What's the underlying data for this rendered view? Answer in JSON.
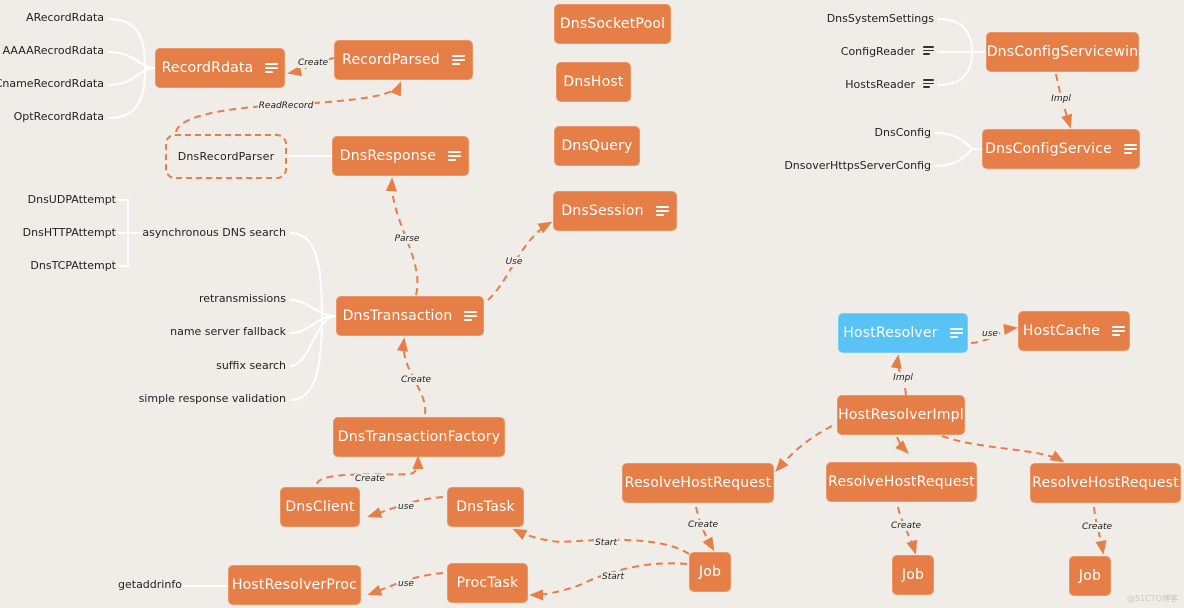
{
  "colors": {
    "node": "#e67e48",
    "highlight": "#58c3f4",
    "background": "#f0ede9",
    "edge": "#e67e48"
  },
  "nodes": {
    "record_rdata": "RecordRdata",
    "record_parsed": "RecordParsed",
    "dns_record_parser": "DnsRecordParser",
    "dns_response": "DnsResponse",
    "dns_socket_pool": "DnsSocketPool",
    "dns_host": "DnsHost",
    "dns_query": "DnsQuery",
    "dns_session": "DnsSession",
    "dns_config_service_win": "DnsConfigServicewin",
    "dns_config_service": "DnsConfigService",
    "dns_transaction": "DnsTransaction",
    "dns_transaction_factory": "DnsTransactionFactory",
    "dns_client": "DnsClient",
    "dns_task": "DnsTask",
    "host_resolver_proc": "HostResolverProc",
    "proc_task": "ProcTask",
    "host_resolver": "HostResolver",
    "host_cache": "HostCache",
    "host_resolver_impl": "HostResolverImpl",
    "resolve_host_request_1": "ResolveHostRequest",
    "resolve_host_request_2": "ResolveHostRequest",
    "resolve_host_request_3": "ResolveHostRequest",
    "job_1": "Job",
    "job_2": "Job",
    "job_3": "Job"
  },
  "leaves": {
    "record_rdata": [
      "ARecordRdata",
      "AAAARecrodRdata",
      "CnameRecordRdata",
      "OptRecordRdata"
    ],
    "dns_config_service_win": [
      "DnsSystemSettings",
      "ConfigReader",
      "HostsReader"
    ],
    "dns_config_service": [
      "DnsConfig",
      "DnsoverHttpsServerConfig"
    ],
    "dns_transaction": [
      "asynchronous DNS search",
      "retransmissions",
      "name server fallback",
      "suffix search",
      "simple response validation"
    ],
    "async_search": [
      "DnsUDPAttempt",
      "DnsHTTPAttempt",
      "DnsTCPAttempt"
    ],
    "host_resolver_proc": [
      "getaddrinfo"
    ]
  },
  "edge_labels": {
    "create_rdata": "Create",
    "read_record": "ReadRecord",
    "parse": "Parse",
    "use_session": "Use",
    "impl_config": "Impl",
    "create_transaction": "Create",
    "create_factory": "Create",
    "use_client": "use",
    "use_proc": "use",
    "start_dns": "Start",
    "start_proc": "Start",
    "use_cache": "use",
    "impl_resolver": "Impl",
    "create_job_1": "Create",
    "create_job_2": "Create",
    "create_job_3": "Create"
  },
  "watermark": "@51CTO博客"
}
